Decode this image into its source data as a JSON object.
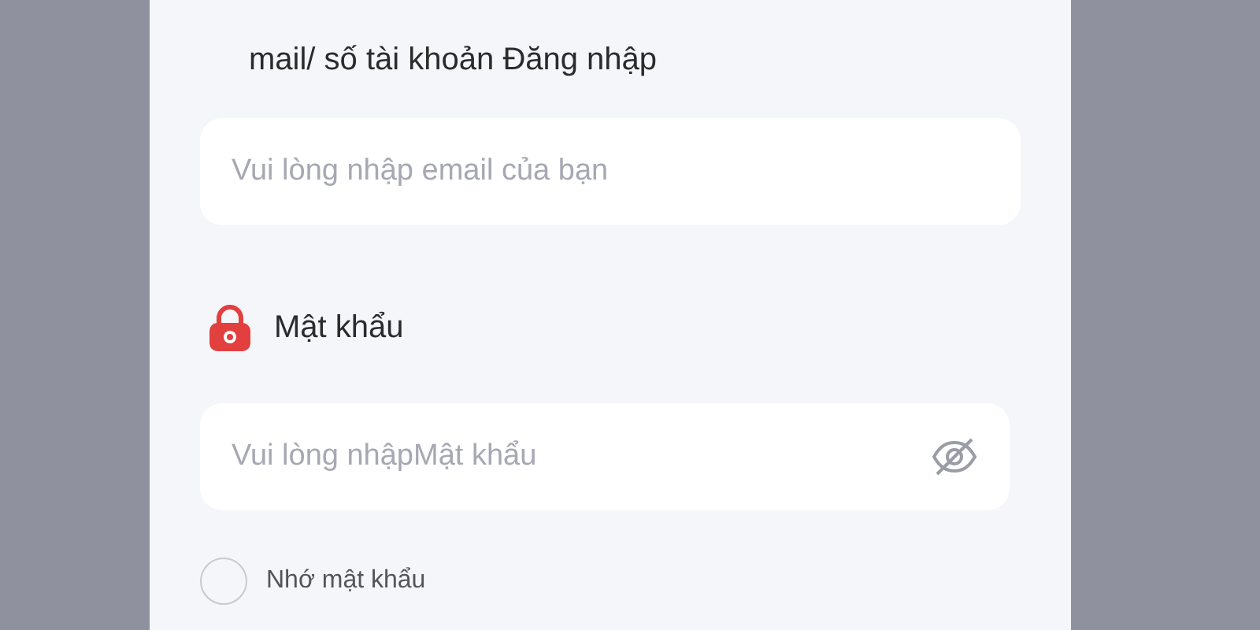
{
  "email_label": "mail/ số tài khoản Đăng nhập",
  "email_field": {
    "placeholder": "Vui lòng nhập email của bạn"
  },
  "password_label": "Mật khẩu",
  "password_field": {
    "placeholder": "Vui lòng nhậpMật khẩu"
  },
  "remember": {
    "label": "Nhớ mật khẩu",
    "checked": false
  }
}
